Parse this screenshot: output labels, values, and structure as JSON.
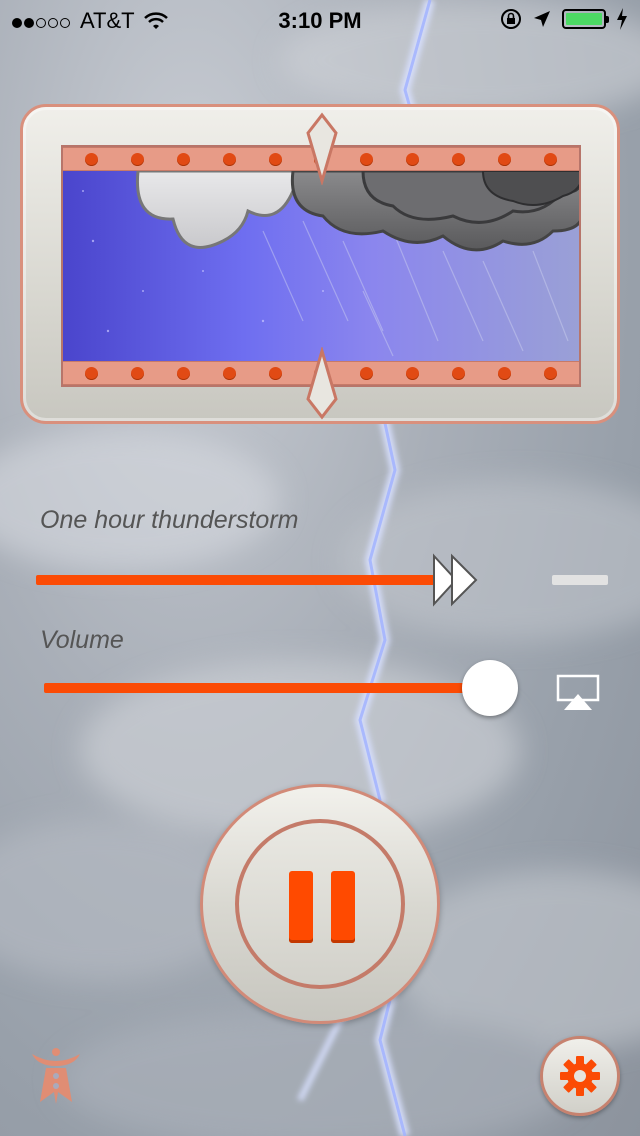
{
  "status_bar": {
    "signal_dots": 5,
    "signal_filled": 2,
    "carrier": "AT&T",
    "time": "3:10 PM",
    "battery_level": 1.0,
    "icons": [
      "wifi-icon",
      "rotation-lock-icon",
      "location-arrow-icon",
      "battery-icon",
      "charging-bolt-icon"
    ]
  },
  "track": {
    "title": "One hour thunderstorm",
    "progress": 0.85
  },
  "volume": {
    "label": "Volume",
    "level": 0.95
  },
  "controls": {
    "play_state": "pause"
  },
  "colors": {
    "accent": "#fb4b05",
    "frame_border": "#d9907d",
    "rivet": "#e14a14"
  }
}
